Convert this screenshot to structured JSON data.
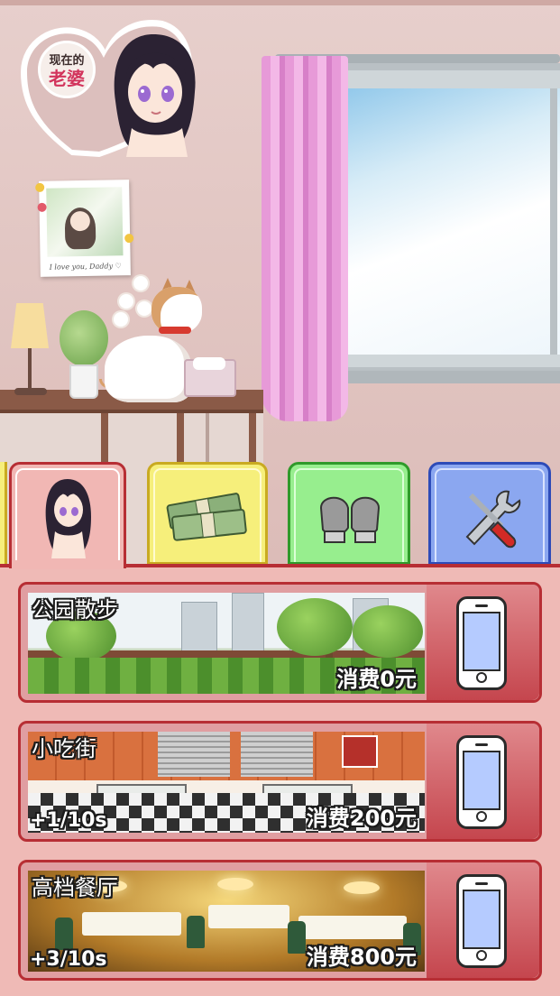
{
  "wife_badge": {
    "line1": "现在的",
    "line2": "老婆"
  },
  "polaroid": {
    "caption": "I love you, Daddy ♡"
  },
  "tabs": [
    {
      "id": "partner",
      "icon": "girl-portrait-icon",
      "color": "#f1b7b4",
      "active": true
    },
    {
      "id": "money",
      "icon": "cash-stack-icon",
      "color": "#f6ef7b"
    },
    {
      "id": "fight",
      "icon": "boxing-gloves-icon",
      "color": "#97ee8e"
    },
    {
      "id": "settings",
      "icon": "wrench-screwdriver-icon",
      "color": "#8ba7f0"
    }
  ],
  "dates": [
    {
      "title": "公园散步",
      "rate": "",
      "cost": "消费0元",
      "action_icon": "phone-icon"
    },
    {
      "title": "小吃街",
      "rate": "+1/10s",
      "cost": "消费200元",
      "action_icon": "phone-icon"
    },
    {
      "title": "高档餐厅",
      "rate": "+3/10s",
      "cost": "消费800元",
      "action_icon": "phone-icon"
    }
  ],
  "colors": {
    "accent": "#b72e34",
    "panel": "#efbab6",
    "phone_screen": "#b5cbff"
  }
}
